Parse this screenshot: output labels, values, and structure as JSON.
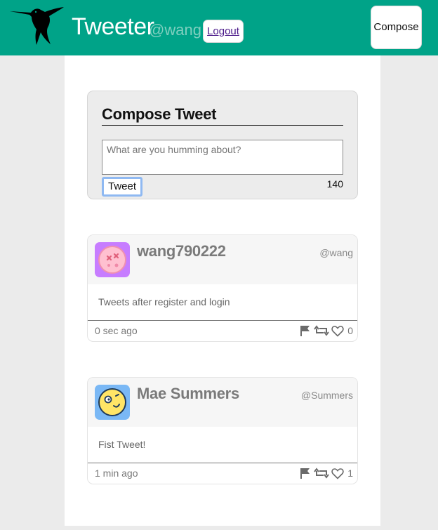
{
  "header": {
    "app_title": "Tweeter",
    "handle": "@wang",
    "logout_label": "Logout",
    "compose_label": "Compose",
    "brand_color": "#00a388",
    "logo_icon": "hummingbird-icon"
  },
  "compose": {
    "heading": "Compose Tweet",
    "placeholder": "What are you humming about?",
    "tweet_label": "Tweet",
    "char_count": "140"
  },
  "tweets": [
    {
      "name": "wang790222",
      "handle": "@wang",
      "text": "Tweets after register and login",
      "time": "0 sec ago",
      "likes": "0",
      "avatar_color": "#c77dff"
    },
    {
      "name": "Mae Summers",
      "handle": "@Summers",
      "text": "Fist Tweet!",
      "time": "1 min ago",
      "likes": "1",
      "avatar_color": "#7ab8f5"
    }
  ]
}
